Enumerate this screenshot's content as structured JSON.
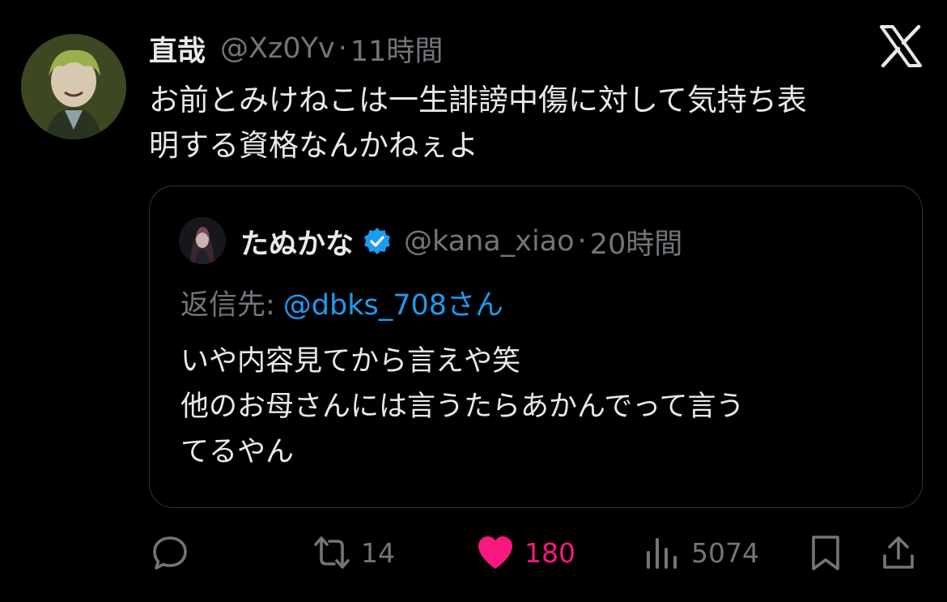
{
  "tweet": {
    "display_name": "直哉",
    "handle": "@Xz0Yv",
    "separator": "·",
    "time": "11時間",
    "text_lines": [
      "お前とみけねこは一生誹謗中傷に対して気持ち表",
      "明する資格なんかねぇよ"
    ]
  },
  "quoted": {
    "display_name": "たぬかな",
    "handle": "@kana_xiao",
    "separator": "·",
    "time": "20時間",
    "reply_label": "返信先:",
    "reply_target": "@dbks_708さん",
    "text_lines": [
      "いや内容見てから言えや笑",
      "他のお母さんには言うたらあかんでって言う",
      "てるやん"
    ]
  },
  "actions": {
    "retweets": "14",
    "likes": "180",
    "views": "5074"
  },
  "icons": [
    "x-logo-icon",
    "verified-badge-icon",
    "reply-icon",
    "retweet-icon",
    "heart-icon",
    "views-icon",
    "bookmark-icon",
    "share-icon"
  ],
  "colors": {
    "background": "#000000",
    "text": "#e7e9ea",
    "secondary": "#71767b",
    "link": "#1d9bf0",
    "like": "#f91880",
    "border": "#2f3336"
  }
}
